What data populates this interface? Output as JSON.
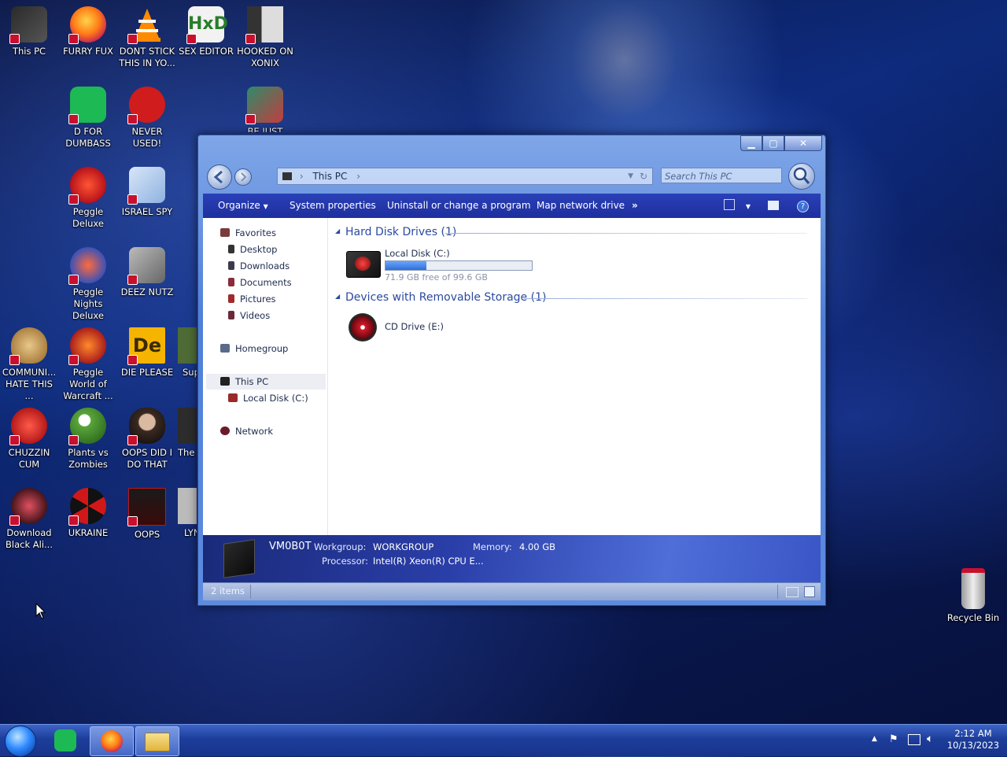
{
  "desktop": {
    "icons": [
      {
        "label": "This PC",
        "icon": "this-pc-icon"
      },
      {
        "label": "FURRY FUX",
        "icon": "firefox-icon"
      },
      {
        "label": "DONT STICK THIS IN YO...",
        "icon": "vlc-icon"
      },
      {
        "label": "SEX EDITOR",
        "icon": "hxd-icon"
      },
      {
        "label": "HOOKED ON XONIX",
        "icon": "xonix-icon"
      },
      {
        "label": "D FOR DUMBASS",
        "icon": "app-icon"
      },
      {
        "label": "NEVER USED!",
        "icon": "devcpp-icon"
      },
      {
        "label": "BE JUST LIKE",
        "icon": "game-icon"
      },
      {
        "label": "Peggle Deluxe",
        "icon": "peggle-icon"
      },
      {
        "label": "ISRAEL SPY",
        "icon": "network-icon"
      },
      {
        "label": "Peggle Nights Deluxe",
        "icon": "peggle-nights-icon"
      },
      {
        "label": "DEEZ NUTZ",
        "icon": "windows-stack-icon"
      },
      {
        "label": "COMMUNI... HATE THIS ...",
        "icon": "money-bag-icon"
      },
      {
        "label": "Peggle World of Warcraft ...",
        "icon": "peggle-wow-icon"
      },
      {
        "label": "DIE PLEASE",
        "icon": "de-icon"
      },
      {
        "label": "Sup",
        "icon": "game-icon"
      },
      {
        "label": "CHUZZIN CUM",
        "icon": "chuzzle-icon"
      },
      {
        "label": "Plants vs Zombies",
        "icon": "pvz-icon"
      },
      {
        "label": "OOPS DID I DO THAT",
        "icon": "portrait-icon"
      },
      {
        "label": "The",
        "icon": "game-icon"
      },
      {
        "label": "Download Black Ali...",
        "icon": "download-icon"
      },
      {
        "label": "UKRAINE",
        "icon": "radiation-icon"
      },
      {
        "label": "OOPS",
        "icon": "oops-icon"
      },
      {
        "label": "LYN",
        "icon": "game-icon"
      },
      {
        "label": "Recycle Bin",
        "icon": "recycle-bin-icon"
      }
    ]
  },
  "window": {
    "address": "This PC",
    "search_placeholder": "Search This PC",
    "commands": [
      "Organize",
      "System properties",
      "Uninstall or change a program",
      "Map network drive",
      "»"
    ],
    "nav": {
      "favorites": "Favorites",
      "desktop": "Desktop",
      "downloads": "Downloads",
      "documents": "Documents",
      "pictures": "Pictures",
      "videos": "Videos",
      "homegroup": "Homegroup",
      "thispc": "This PC",
      "localdisk": "Local Disk (C:)",
      "network": "Network"
    },
    "groups": {
      "hdd": "Hard Disk Drives (1)",
      "removable": "Devices with Removable Storage (1)"
    },
    "drives": {
      "c_name": "Local Disk (C:)",
      "c_free": "71.9 GB free of 99.6 GB",
      "c_used_fraction": 0.28,
      "cd_name": "CD Drive (E:)"
    },
    "details": {
      "computer": "VM0B0T",
      "workgroup_label": "Workgroup:",
      "workgroup": "WORKGROUP",
      "memory_label": "Memory:",
      "memory": "4.00 GB",
      "processor_label": "Processor:",
      "processor": "Intel(R) Xeon(R) CPU E..."
    },
    "status": "2 items"
  },
  "taskbar": {
    "time": "2:12 AM",
    "date": "10/13/2023"
  },
  "colors": {
    "accent": "#1e2f9e",
    "drive_bar": "#2f6fd6"
  }
}
